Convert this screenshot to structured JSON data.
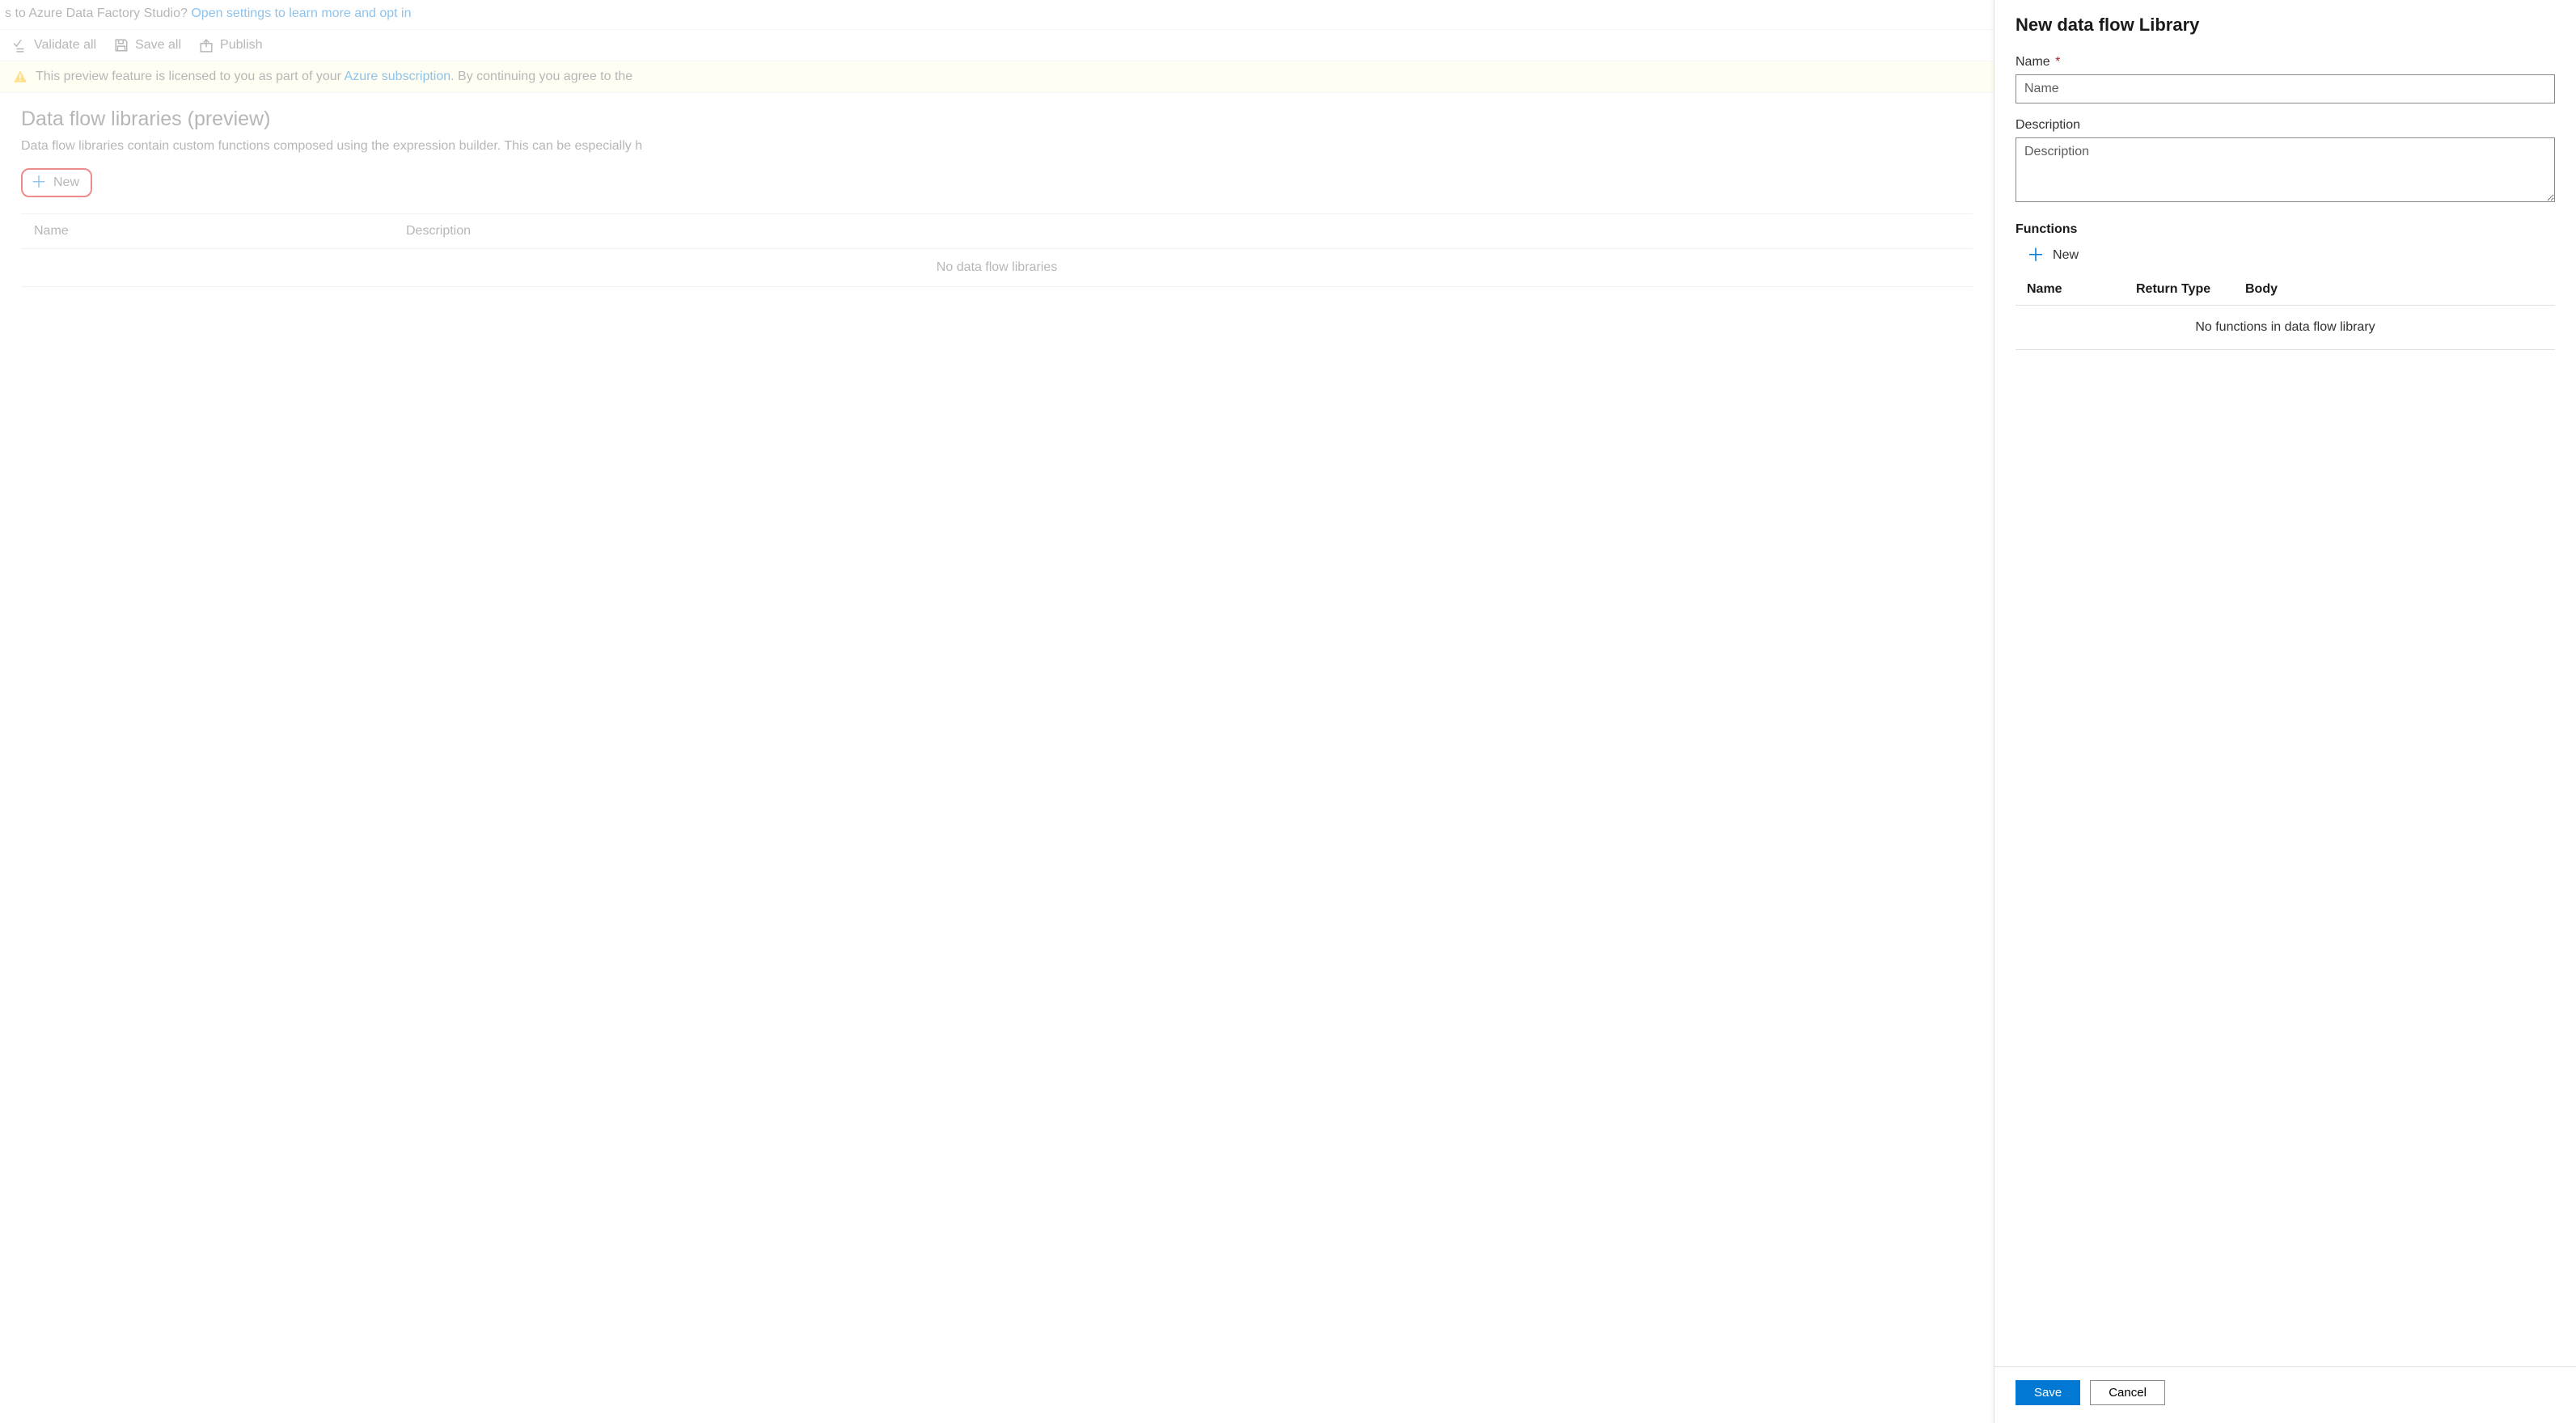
{
  "banner": {
    "prefix_text": "s to Azure Data Factory Studio? ",
    "link_text": "Open settings to learn more and opt in"
  },
  "toolbar": {
    "validate_all": "Validate all",
    "save_all": "Save all",
    "publish": "Publish"
  },
  "info_bar": {
    "text_before": "This preview feature is licensed to you as part of your ",
    "link_text": "Azure subscription.",
    "text_after": " By continuing you agree to the"
  },
  "page": {
    "title": "Data flow libraries (preview)",
    "description": "Data flow libraries contain custom functions composed using the expression builder. This can be especially h",
    "new_button": "New",
    "table": {
      "col_name": "Name",
      "col_description": "Description",
      "empty_text": "No data flow libraries"
    }
  },
  "panel": {
    "title": "New data flow Library",
    "name_label": "Name",
    "name_placeholder": "Name",
    "description_label": "Description",
    "description_placeholder": "Description",
    "functions_label": "Functions",
    "functions_new": "New",
    "func_col_name": "Name",
    "func_col_return": "Return Type",
    "func_col_body": "Body",
    "func_empty": "No functions in data flow library",
    "save": "Save",
    "cancel": "Cancel"
  }
}
